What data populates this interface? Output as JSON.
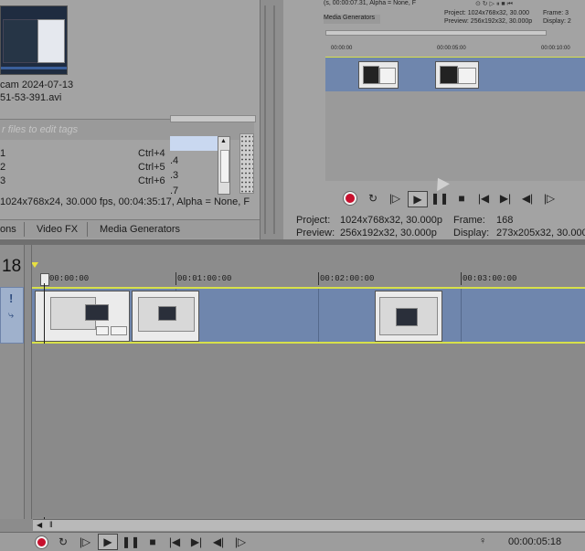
{
  "media_panel": {
    "file_name_line1": "cam 2024-07-13",
    "file_name_line2": "51-53-391.avi",
    "tags_placeholder": "r files to edit tags",
    "shortcuts": [
      {
        "key": "1",
        "shortcut": "Ctrl+4"
      },
      {
        "key": "2",
        "shortcut": "Ctrl+5"
      },
      {
        "key": "3",
        "shortcut": "Ctrl+6"
      }
    ],
    "side_numbers": [
      ".4",
      ".3",
      ".7"
    ],
    "media_info": "1024x768x24, 30.000 fps, 00:04:35:17, Alpha = None, F"
  },
  "tabs": [
    "ons",
    "Video FX",
    "Media Generators"
  ],
  "small_preview": {
    "info_line": "(s, 00:00:07.31, Alpha = None, F",
    "tab": "Media Generators",
    "project_label": "Project:",
    "project_value": "1024x768x32, 30.000",
    "preview_label": "Preview:",
    "preview_value": "256x192x32, 30.000p",
    "frame_label": "Frame:",
    "frame_value": "3",
    "display_label": "Display:",
    "display_value": "2",
    "ruler_labels": [
      "00:00:00",
      "00:00:05:00",
      "00:00:10:00"
    ]
  },
  "preview": {
    "project_label": "Project:",
    "project_value": "1024x768x32, 30.000p",
    "preview_label": "Preview:",
    "preview_value": "256x192x32, 30.000p",
    "frame_label": "Frame:",
    "frame_value": "168",
    "display_label": "Display:",
    "display_value": "273x205x32, 30.000"
  },
  "timeline": {
    "track_number": "18",
    "ruler_labels": [
      "00:00:00",
      "00:01:00:00",
      "00:02:00:00",
      "00:03:00:00"
    ]
  },
  "transport": {
    "timecode": "00:00:05:18"
  },
  "colors": {
    "track_blue": "#6f86ad",
    "clip_border": "#d8e04a",
    "record_red": "#c8102e"
  }
}
